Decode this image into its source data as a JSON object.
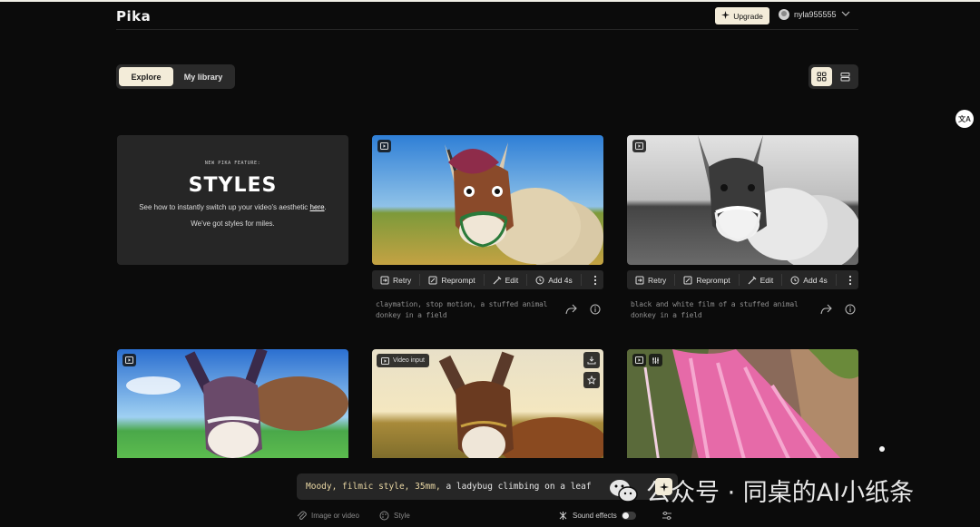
{
  "header": {
    "logo": "Pika",
    "upgrade_label": "Upgrade",
    "username": "nyla955555"
  },
  "tabs": [
    {
      "label": "Explore",
      "active": true
    },
    {
      "label": "My library",
      "active": false
    }
  ],
  "view_modes": [
    "grid-view",
    "list-view"
  ],
  "promo": {
    "kicker": "NEW PIKA FEATURE:",
    "title": "STYLES",
    "text_before_link": "See how to instantly switch up your video's aesthetic ",
    "link": "here",
    "text_after_link": ".",
    "subtext": "We've got styles for miles."
  },
  "actions": {
    "retry": "Retry",
    "reprompt": "Reprompt",
    "edit": "Edit",
    "add": "Add 4s"
  },
  "videos": [
    {
      "caption": "claymation, stop motion, a stuffed animal donkey in a field"
    },
    {
      "caption": "black and white film of a stuffed animal donkey in a field"
    }
  ],
  "row2": {
    "video_input_label": "Video input"
  },
  "prompt": {
    "styled_part": "Moody, filmic style, 35mm,",
    "rest": " a ladybug climbing on a leaf"
  },
  "bottom_tools": {
    "image_or_video": "Image or video",
    "style": "Style",
    "sound_effects": "Sound effects"
  },
  "watermark": {
    "text": "公众号 · 同桌的AI小纸条"
  },
  "colors": {
    "accent": "#f3ecd9",
    "background": "#0b0b0b",
    "card": "#262626"
  }
}
